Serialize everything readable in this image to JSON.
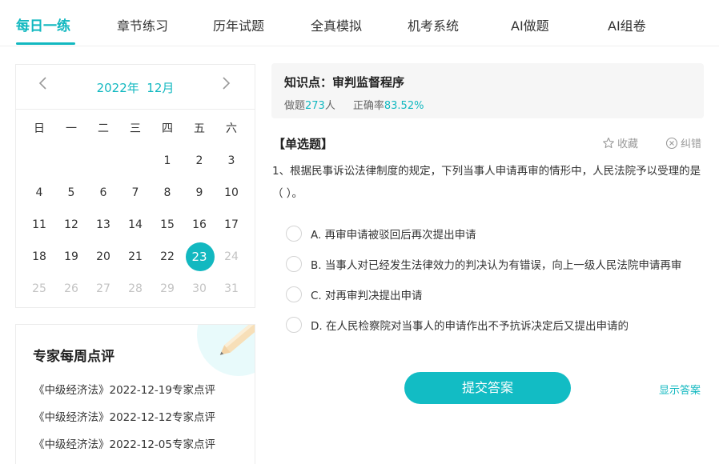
{
  "tabs": [
    {
      "label": "每日一练",
      "active": true
    },
    {
      "label": "章节练习"
    },
    {
      "label": "历年试题"
    },
    {
      "label": "全真模拟"
    },
    {
      "label": "机考系统"
    },
    {
      "label": "AI做题"
    },
    {
      "label": "AI组卷"
    }
  ],
  "calendar": {
    "title": "2022年  12月",
    "weekdays": [
      "日",
      "一",
      "二",
      "三",
      "四",
      "五",
      "六"
    ],
    "rows": [
      [
        {
          "d": ""
        },
        {
          "d": ""
        },
        {
          "d": ""
        },
        {
          "d": ""
        },
        {
          "d": "1"
        },
        {
          "d": "2"
        },
        {
          "d": "3"
        }
      ],
      [
        {
          "d": "4"
        },
        {
          "d": "5"
        },
        {
          "d": "6"
        },
        {
          "d": "7"
        },
        {
          "d": "8"
        },
        {
          "d": "9"
        },
        {
          "d": "10"
        }
      ],
      [
        {
          "d": "11"
        },
        {
          "d": "12"
        },
        {
          "d": "13"
        },
        {
          "d": "14"
        },
        {
          "d": "15"
        },
        {
          "d": "16"
        },
        {
          "d": "17"
        }
      ],
      [
        {
          "d": "18"
        },
        {
          "d": "19"
        },
        {
          "d": "20"
        },
        {
          "d": "21"
        },
        {
          "d": "22"
        },
        {
          "d": "23",
          "today": true
        },
        {
          "d": "24",
          "muted": true
        }
      ],
      [
        {
          "d": "25",
          "muted": true
        },
        {
          "d": "26",
          "muted": true
        },
        {
          "d": "27",
          "muted": true
        },
        {
          "d": "28",
          "muted": true
        },
        {
          "d": "29",
          "muted": true
        },
        {
          "d": "30",
          "muted": true
        },
        {
          "d": "31",
          "muted": true
        }
      ]
    ]
  },
  "expert": {
    "title": "专家每周点评",
    "items": [
      "《中级经济法》2022-12-19专家点评",
      "《中级经济法》2022-12-12专家点评",
      "《中级经济法》2022-12-05专家点评"
    ]
  },
  "knowledge": {
    "title": "知识点：审判监督程序",
    "done_label": "做题",
    "done_count": "273",
    "done_unit": "人",
    "accuracy_label": "正确率",
    "accuracy_value": "83.52%"
  },
  "question": {
    "type": "【单选题】",
    "favorite_label": "收藏",
    "report_label": "纠错",
    "stem": "1、根据民事诉讼法律制度的规定，下列当事人申请再审的情形中，人民法院予以受理的是（   ）。",
    "options": [
      "A. 再审申请被驳回后再次提出申请",
      "B. 当事人对已经发生法律效力的判决认为有错误，向上一级人民法院申请再审",
      "C. 对再审判决提出申请",
      "D. 在人民检察院对当事人的申请作出不予抗诉决定后又提出申请的"
    ]
  },
  "actions": {
    "submit_label": "提交答案",
    "show_answer_label": "显示答案"
  },
  "colors": {
    "accent": "#12b8c0"
  }
}
